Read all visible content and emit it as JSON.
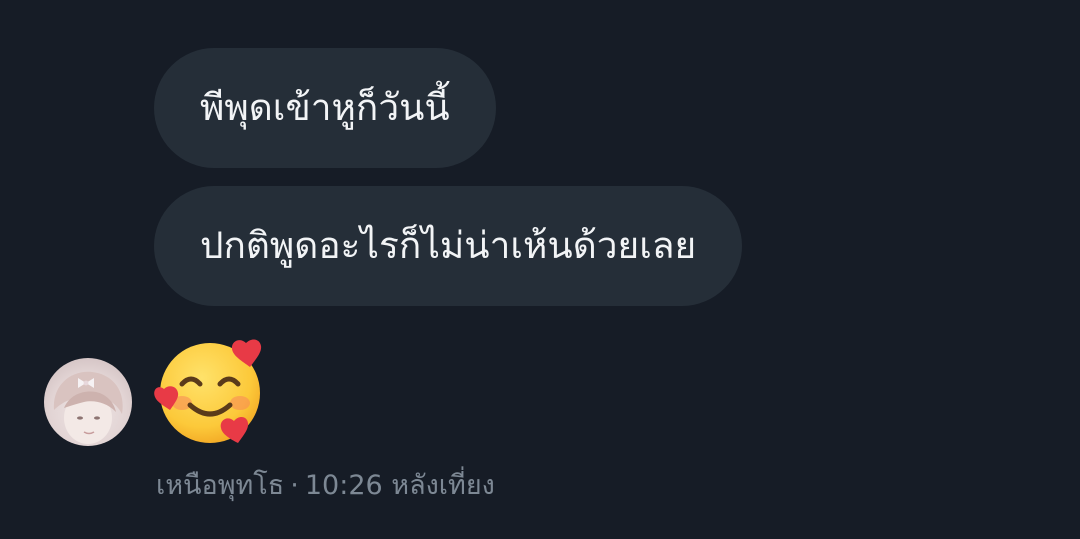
{
  "messages": [
    {
      "text": "พีพุดเข้าหูก็วันนี้"
    },
    {
      "text": "ปกติพูดอะไรก็ไม่น่าเห้นด้วยเลย"
    },
    {
      "emoji": "smiling-face-with-hearts"
    }
  ],
  "footer": {
    "sender": "เหนือพุทโธ",
    "separator": "·",
    "time": "10:26 หลังเที่ยง"
  },
  "colors": {
    "background": "#161c26",
    "bubble": "#252e38",
    "text": "#f2f4f6",
    "meta": "#7d8894"
  }
}
